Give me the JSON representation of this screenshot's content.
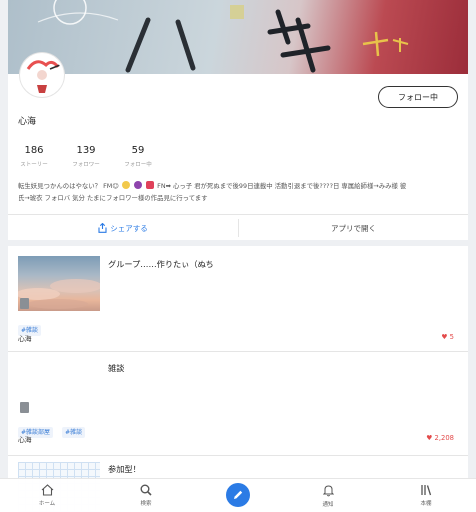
{
  "profile": {
    "name": "心海",
    "follow_button": "フォロー中",
    "stats": [
      {
        "value": "186",
        "label": "ストーリー"
      },
      {
        "value": "139",
        "label": "フォロワー"
      },
      {
        "value": "59",
        "label": "フォロー中"
      }
    ],
    "bio_lines": [
      "転生妖見つかんのはやない？ FM☺",
      "FN➡ 心っ子 君が死ぬまで後99日連載中 活動引退まで後????日 専属絵師様→みみ様 彼",
      "氏→琥衣 フォロバ 気分 たまにフォロワー様の作品見に行ってます"
    ],
    "share_label": "シェアする",
    "open_app_label": "アプリで開く"
  },
  "stories": [
    {
      "title": "グループ……作りたぃ（ぬち",
      "tags": [
        "#雑談"
      ],
      "author": "心海",
      "likes": "5"
    },
    {
      "title": "雑談",
      "tags": [
        "#雑談部屋",
        "#雑談"
      ],
      "author": "心海",
      "likes": "2,208"
    },
    {
      "title": "参加型！",
      "tags": [],
      "author": "",
      "likes": ""
    }
  ],
  "tabbar": {
    "home": "ホーム",
    "search": "検索",
    "notify": "通知",
    "bookshelf": "本棚"
  },
  "colors": {
    "accent": "#2b7be5",
    "like": "#e34b4b"
  },
  "icons": {
    "share": "share-icon",
    "heart": "heart-icon",
    "home": "home-icon",
    "search": "search-icon",
    "compose": "pencil-icon",
    "notify": "bell-icon",
    "bookshelf": "bookshelf-icon"
  }
}
